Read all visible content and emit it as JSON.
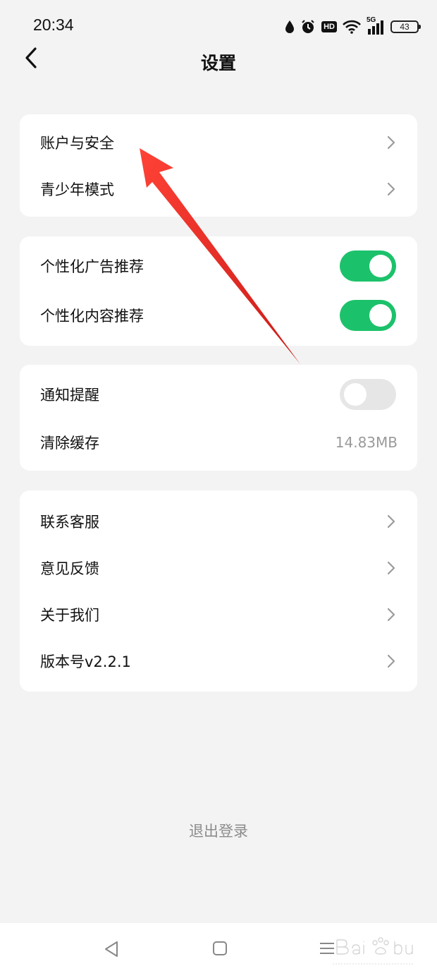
{
  "status_bar": {
    "time": "20:34",
    "hd_label": "HD",
    "network_label": "5G",
    "battery": "43"
  },
  "header": {
    "title": "设置"
  },
  "groups": [
    {
      "rows": [
        {
          "label": "账户与安全",
          "type": "link"
        },
        {
          "label": "青少年模式",
          "type": "link"
        }
      ]
    },
    {
      "rows": [
        {
          "label": "个性化广告推荐",
          "type": "toggle",
          "enabled": true
        },
        {
          "label": "个性化内容推荐",
          "type": "toggle",
          "enabled": true
        }
      ]
    },
    {
      "rows": [
        {
          "label": "通知提醒",
          "type": "toggle",
          "enabled": false
        },
        {
          "label": "清除缓存",
          "type": "value",
          "value": "14.83MB"
        }
      ]
    },
    {
      "rows": [
        {
          "label": "联系客服",
          "type": "link"
        },
        {
          "label": "意见反馈",
          "type": "link"
        },
        {
          "label": "关于我们",
          "type": "link"
        },
        {
          "label": "版本号v2.2.1",
          "type": "link"
        }
      ]
    }
  ],
  "logout_label": "退出登录",
  "colors": {
    "background": "#f3f3f3",
    "card": "#ffffff",
    "toggle_on": "#1cc26b",
    "toggle_off": "#e6e6e6",
    "annotation_arrow": "#e8231d"
  },
  "icons": {
    "back": "chevron-left-icon",
    "row_link": "chevron-right-icon",
    "nav_back": "triangle-back-icon",
    "nav_home": "square-home-icon",
    "nav_menu": "menu-lines-icon"
  }
}
